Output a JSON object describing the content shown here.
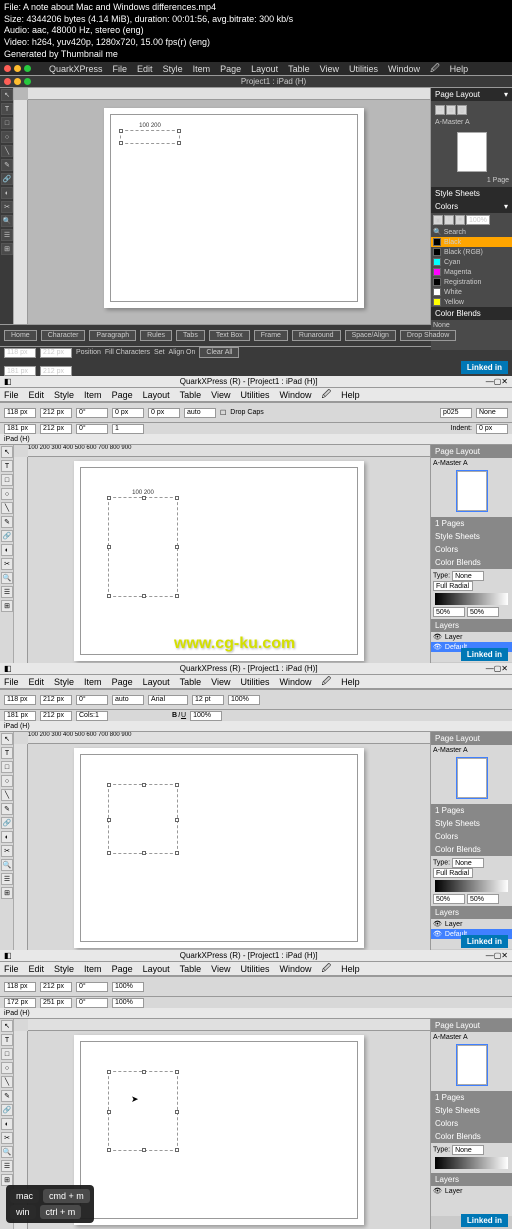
{
  "header": {
    "file": "File: A note about Mac and Windows differences.mp4",
    "size": "Size: 4344206 bytes (4.14 MiB), duration: 00:01:56, avg.bitrate: 300 kb/s",
    "audio": "Audio: aac, 48000 Hz, stereo (eng)",
    "video": "Video: h264, yuv420p, 1280x720, 15.00 fps(r) (eng)",
    "gen": "Generated by Thumbnail me"
  },
  "app": "QuarkXPress",
  "menus": [
    "File",
    "Edit",
    "Style",
    "Item",
    "Page",
    "Layout",
    "Table",
    "View",
    "Utilities",
    "Window",
    "Help"
  ],
  "menuIcon": "🖉",
  "title_mac": "Project1 : iPad (H)",
  "title_win": "QuarkXPress (R) - [Project1 : iPad (H)]",
  "tab": "iPad (H)",
  "tools": [
    "↖",
    "T",
    "□",
    "○",
    "╲",
    "✎",
    "🔗",
    "◐",
    "✂",
    "🔍",
    "☰",
    "⊞"
  ],
  "measure": {
    "tabs": [
      "Home",
      "Character",
      "Paragraph",
      "Rules",
      "Tabs",
      "Text Box",
      "Frame",
      "Runaround",
      "Space/Align",
      "Drop Shadow"
    ],
    "X": "118 px",
    "Y": "181 px",
    "W": "212 px",
    "H": "212 px",
    "angle": "0°",
    "skew": "0°",
    "cols": "1",
    "opacity": "100%",
    "font": "Arial",
    "size": "12 pt",
    "auto": "auto",
    "dropcaps": "Drop Caps",
    "position": "Position",
    "fill": "Fill Characters",
    "set": "Set",
    "align": "Align On",
    "clear": "Clear All",
    "indent": "Indent:",
    "zero": "0 px",
    "none": "None",
    "p025": "p025"
  },
  "panels": {
    "pageLayout": "Page Layout",
    "master": "A-Master A",
    "pageNum": "1 Page",
    "pages": "1 Pages",
    "styleSheets": "Style Sheets",
    "colors": "Colors",
    "colorBlends": "Color Blends",
    "layers": "Layers",
    "layer": "Layer",
    "default": "Default",
    "search": "Search",
    "type": "Type:",
    "noneOpt": "None",
    "fullRadial": "Full Radial",
    "p50": "50%",
    "p100": "100%"
  },
  "colorList": [
    {
      "name": "Black",
      "hex": "#000"
    },
    {
      "name": "Black (RGB)",
      "hex": "#000"
    },
    {
      "name": "Cyan",
      "hex": "#0ff"
    },
    {
      "name": "Magenta",
      "hex": "#f0f"
    },
    {
      "name": "Registration",
      "hex": "#000"
    },
    {
      "name": "White",
      "hex": "#fff"
    },
    {
      "name": "Yellow",
      "hex": "#ff0"
    }
  ],
  "shortcuts": {
    "mac": "mac",
    "win": "win",
    "mcmd": "cmd + m",
    "wcmd": "ctrl + m"
  },
  "watermark": "www.cg-ku.com",
  "linkedin": "Linked in",
  "ruler": {
    "marks": "100    200",
    "marksWide": "100  200  300  400  500  600  700  800  900"
  }
}
